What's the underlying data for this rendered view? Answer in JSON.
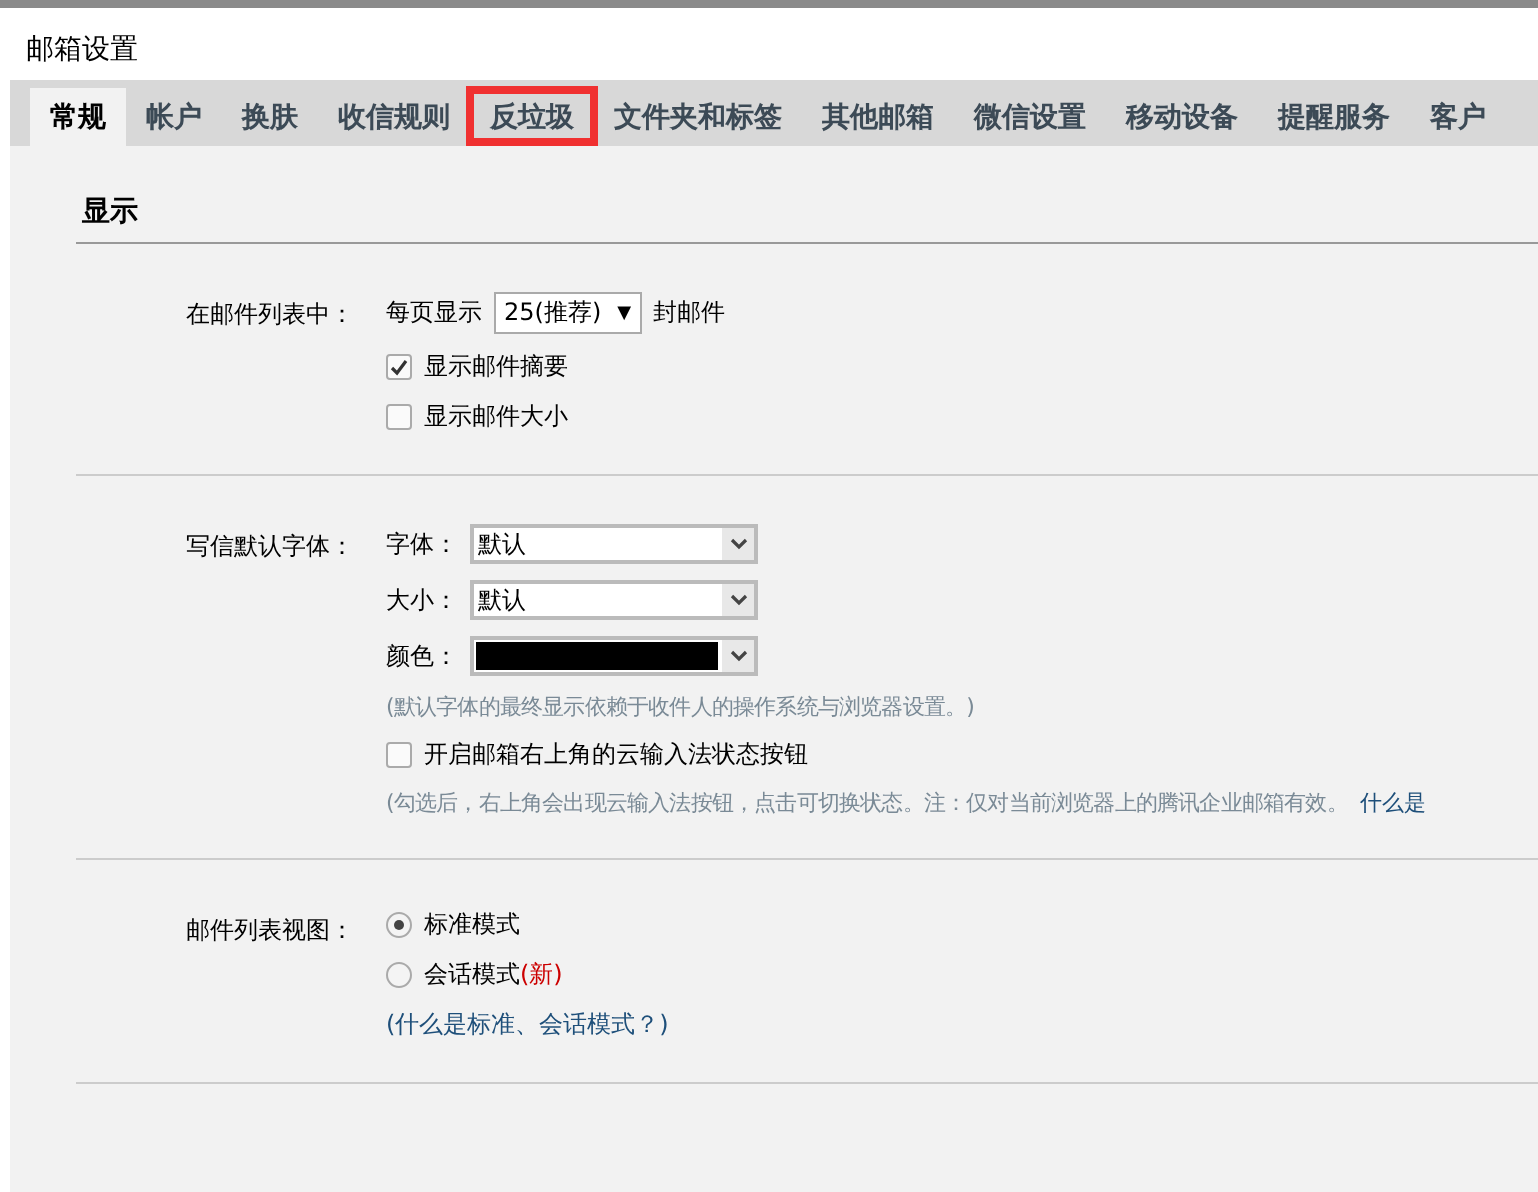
{
  "window": {
    "title": "邮箱设置"
  },
  "tabs": [
    {
      "label": "常规",
      "selected": true,
      "highlighted": false
    },
    {
      "label": "帐户",
      "selected": false,
      "highlighted": false
    },
    {
      "label": "换肤",
      "selected": false,
      "highlighted": false
    },
    {
      "label": "收信规则",
      "selected": false,
      "highlighted": false
    },
    {
      "label": "反垃圾",
      "selected": false,
      "highlighted": true
    },
    {
      "label": "文件夹和标签",
      "selected": false,
      "highlighted": false
    },
    {
      "label": "其他邮箱",
      "selected": false,
      "highlighted": false
    },
    {
      "label": "微信设置",
      "selected": false,
      "highlighted": false
    },
    {
      "label": "移动设备",
      "selected": false,
      "highlighted": false
    },
    {
      "label": "提醒服务",
      "selected": false,
      "highlighted": false
    },
    {
      "label": "客户",
      "selected": false,
      "highlighted": false
    }
  ],
  "section": {
    "title": "显示"
  },
  "groups": [
    {
      "label": "在邮件列表中：",
      "items": [
        {
          "kind": "inline-select",
          "prefix": "每页显示",
          "value": "25(推荐)",
          "arrow": "▼",
          "suffix": "封邮件"
        },
        {
          "kind": "checkbox",
          "label": "显示邮件摘要",
          "checked": true
        },
        {
          "kind": "checkbox",
          "label": "显示邮件大小",
          "checked": false
        }
      ]
    },
    {
      "label": "写信默认字体：",
      "items": [
        {
          "kind": "select",
          "label": "字体：",
          "value": "默认"
        },
        {
          "kind": "select",
          "label": "大小：",
          "value": "默认"
        },
        {
          "kind": "color",
          "label": "颜色：",
          "color": "#000000"
        },
        {
          "kind": "hint",
          "text": "(默认字体的最终显示依赖于收件人的操作系统与浏览器设置。)"
        },
        {
          "kind": "checkbox",
          "label": "开启邮箱右上角的云输入法状态按钮",
          "checked": false
        },
        {
          "kind": "hint",
          "text": "(勾选后，右上角会出现云输入法按钮，点击可切换状态。注：仅对当前浏览器上的腾讯企业邮箱有效。",
          "link": "什么是"
        }
      ]
    },
    {
      "label": "邮件列表视图：",
      "items": [
        {
          "kind": "radio",
          "label": "标准模式",
          "selected": true
        },
        {
          "kind": "radio",
          "label": "会话模式",
          "badge": "(新)",
          "selected": false
        },
        {
          "kind": "link",
          "text": "(什么是标准、会话模式？)"
        }
      ]
    }
  ]
}
